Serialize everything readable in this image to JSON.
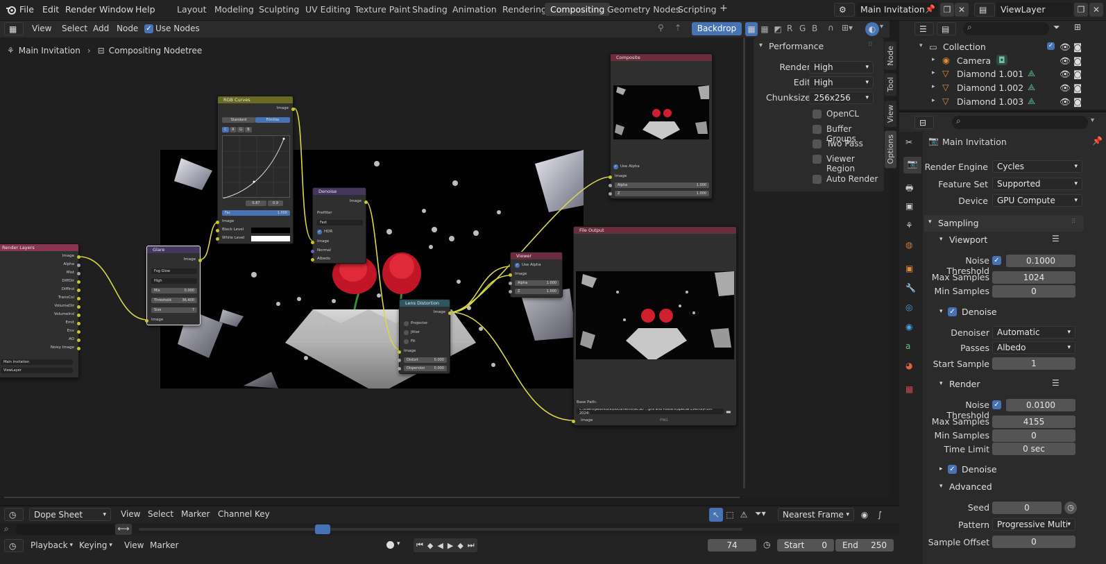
{
  "menu": [
    "File",
    "Edit",
    "Render",
    "Window",
    "Help"
  ],
  "workspaces": [
    "Layout",
    "Modeling",
    "Sculpting",
    "UV Editing",
    "Texture Paint",
    "Shading",
    "Animation",
    "Rendering",
    "Compositing",
    "Geometry Nodes",
    "Scripting"
  ],
  "active_workspace": "Compositing",
  "scene": "Main Invitation",
  "view_layer": "ViewLayer",
  "node_header": {
    "items": [
      "View",
      "Select",
      "Add",
      "Node"
    ],
    "use_nodes": "Use Nodes",
    "backdrop": "Backdrop",
    "channels": [
      "R",
      "G",
      "B"
    ]
  },
  "breadcrumb": {
    "scene": "Main Invitation",
    "tree": "Compositing Nodetree"
  },
  "side_tabs": [
    "Node",
    "Tool",
    "View",
    "Options"
  ],
  "performance": {
    "title": "Performance",
    "render_label": "Render",
    "render_value": "High",
    "edit_label": "Edit",
    "edit_value": "High",
    "chunk_label": "Chunksize",
    "chunk_value": "256x256",
    "checks": [
      "OpenCL",
      "Buffer Groups",
      "Two Pass",
      "Viewer Region",
      "Auto Render"
    ]
  },
  "nodes": {
    "render_layers": {
      "title": "Render Layers",
      "outputs": [
        "Image",
        "Alpha",
        "Mist",
        "DiffDir",
        "DiffInd",
        "TransCol",
        "VolumeDir",
        "VolumeInd",
        "Emit",
        "Env",
        "AO",
        "Noisy Image"
      ],
      "scene": "Main Invitation",
      "layer": "ViewLayer"
    },
    "glare": {
      "title": "Glare",
      "out": "Image",
      "type": "Fog Glow",
      "quality": "High",
      "mix_l": "Mix",
      "mix_v": "0.000",
      "thr_l": "Threshold",
      "thr_v": "36.400",
      "size_l": "Size",
      "size_v": "7",
      "in": "Image"
    },
    "curves": {
      "title": "RGB Curves",
      "out": "Image",
      "std": "Standard",
      "film": "Filmlike",
      "ch": [
        "C",
        "R",
        "G",
        "B"
      ],
      "v1": "0.87",
      "v2": "0.9",
      "fac_l": "Fac",
      "fac_v": "1.000",
      "in": "Image",
      "black": "Black Level",
      "white": "White Level"
    },
    "denoise": {
      "title": "Denoise",
      "out": "Image",
      "prefilter": "Prefilter",
      "pf_val": "Fast",
      "hdr": "HDR",
      "ins": [
        "Image",
        "Normal",
        "Albedo"
      ]
    },
    "lens": {
      "title": "Lens Distortion",
      "out": "Image",
      "opts": [
        "Projector",
        "Jitter",
        "Fit"
      ],
      "in": "Image",
      "d_l": "Distort",
      "d_v": "0.000",
      "disp_l": "Dispersion",
      "disp_v": "0.000"
    },
    "viewer": {
      "title": "Viewer",
      "use_alpha": "Use Alpha",
      "in": "Image",
      "a_l": "Alpha",
      "a_v": "1.000",
      "z_l": "Z",
      "z_v": "1.000"
    },
    "composite": {
      "title": "Composite",
      "use_alpha": "Use Alpha",
      "in": "Image",
      "a_l": "Alpha",
      "a_v": "1.000",
      "z_l": "Z",
      "z_v": "1.000"
    },
    "fileout": {
      "title": "File Output",
      "base": "Base Path:",
      "path": "C:\\Users\\jasontuck\\Documents\\NCSD ...gns and Posters\\Special Events\\Prom 2024\\",
      "fmt": "PNG",
      "in": "Image"
    }
  },
  "outliner": {
    "collection": "Collection",
    "items": [
      "Camera",
      "Diamond 1.001",
      "Diamond 1.002",
      "Diamond 1.003"
    ]
  },
  "properties": {
    "title": "Main Invitation",
    "render_engine_l": "Render Engine",
    "render_engine": "Cycles",
    "feature_set_l": "Feature Set",
    "feature_set": "Supported",
    "device_l": "Device",
    "device": "GPU Compute",
    "sampling": "Sampling",
    "viewport": "Viewport",
    "vp_noise_l": "Noise Threshold",
    "vp_noise": "0.1000",
    "vp_max_l": "Max Samples",
    "vp_max": "1024",
    "vp_min_l": "Min Samples",
    "vp_min": "0",
    "vp_denoise": "Denoise",
    "denoiser_l": "Denoiser",
    "denoiser": "Automatic",
    "passes_l": "Passes",
    "passes": "Albedo",
    "start_l": "Start Sample",
    "start": "1",
    "render": "Render",
    "r_noise_l": "Noise Threshold",
    "r_noise": "0.0100",
    "r_max_l": "Max Samples",
    "r_max": "4155",
    "r_min_l": "Min Samples",
    "r_min": "0",
    "time_l": "Time Limit",
    "time": "0 sec",
    "r_denoise": "Denoise",
    "advanced": "Advanced",
    "seed_l": "Seed",
    "seed": "0",
    "pattern_l": "Pattern",
    "pattern": "Progressive Multi-Ji...",
    "offset_l": "Sample Offset",
    "offset": "0"
  },
  "timeline": {
    "editor": "Dope Sheet",
    "items": [
      "View",
      "Select",
      "Marker",
      "Channel",
      "Key"
    ],
    "snap": "Nearest Frame",
    "playback": "Playback",
    "keying": "Keying",
    "view": "View",
    "marker": "Marker",
    "frame": "74",
    "start_l": "Start",
    "start": "0",
    "end_l": "End",
    "end": "250"
  },
  "colors": {
    "accent": "#4772b3",
    "socket_image": "#c7c729",
    "link": "#d8d84a"
  }
}
